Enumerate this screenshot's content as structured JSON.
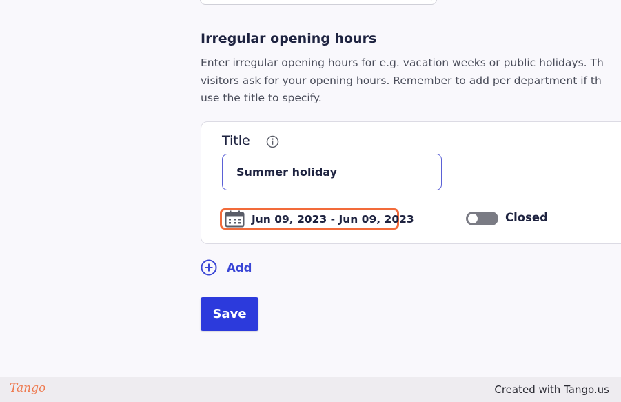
{
  "irregular_hours": {
    "heading": "Irregular opening hours",
    "description_lines": [
      "Enter irregular opening hours for e.g. vacation weeks or public holidays. Th",
      "visitors ask for your opening hours. Remember to add per department if th",
      "use the title to specify."
    ],
    "entry": {
      "title_label": "Title",
      "title_value": "Summer holiday",
      "date_range": "Jun 09, 2023 - Jun 09, 2023",
      "closed_label": "Closed",
      "closed_toggle_on": false
    },
    "add_label": "Add",
    "save_label": "Save"
  },
  "icons": {
    "info": "info-circle-icon",
    "calendar": "calendar-icon",
    "add": "plus-circle-icon"
  },
  "colors": {
    "accent": "#2c3adc",
    "highlight": "#f26b3a",
    "input_border": "#5b61d6",
    "toggle_off": "#7a7b84"
  },
  "footer": {
    "logo_text": "Tango",
    "credit": "Created with Tango.us"
  }
}
